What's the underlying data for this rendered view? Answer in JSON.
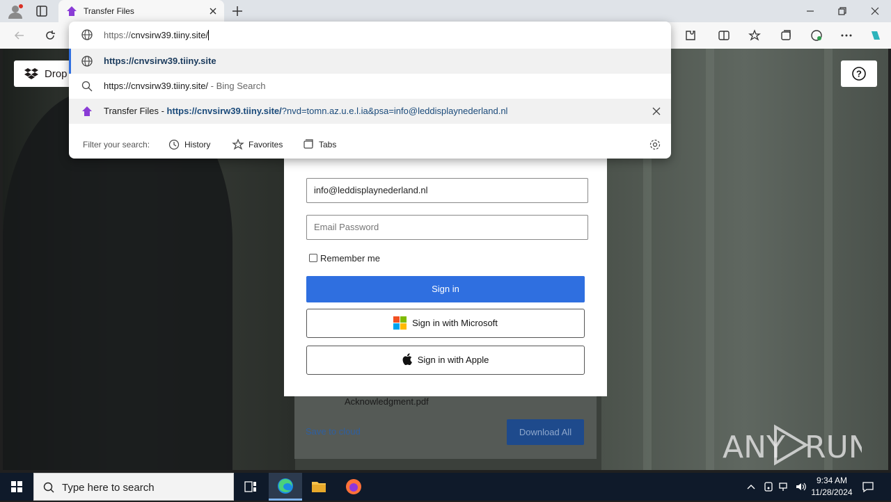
{
  "browser": {
    "tab_title": "Transfer Files",
    "address_typed_prefix": "https://",
    "address_typed_host": "cnvsirw39.tiiny.site/"
  },
  "omnibox": {
    "suggestions": [
      {
        "text": "https://cnvsirw39.tiiny.site",
        "icon": "globe-icon"
      },
      {
        "text": "https://cnvsirw39.tiiny.site/",
        "suffix": " - Bing Search",
        "icon": "search-icon"
      },
      {
        "title": "Transfer Files",
        "separator": " - ",
        "url_bold": "https://cnvsirw39.tiiny.site/",
        "url_rest": "?nvd=tomn.az.u.e.l.ia&psa=info@leddisplaynederland.nl",
        "icon": "transfer-favicon"
      }
    ],
    "filter_label": "Filter your search:",
    "filters": [
      "History",
      "Favorites",
      "Tabs"
    ]
  },
  "page": {
    "dropbox_label": "Drop",
    "email_value": "info@leddisplaynederland.nl",
    "password_placeholder": "Email Password",
    "remember_label": "Remember me",
    "signin_label": "Sign in",
    "microsoft_label": "Sign in with Microsoft",
    "apple_label": "Sign in with Apple",
    "file_name": "Acknowledgment.pdf",
    "save_to_cloud": "Save to cloud",
    "download_all": "Download All",
    "watermark": "ANY RUN"
  },
  "taskbar": {
    "search_placeholder": "Type here to search",
    "time": "9:34 AM",
    "date": "11/28/2024"
  },
  "colors": {
    "accent": "#2f6fe0",
    "taskbar": "#0f1a2a",
    "ms_red": "#f25022",
    "ms_green": "#7fba00",
    "ms_blue": "#00a4ef",
    "ms_yellow": "#ffb900"
  }
}
